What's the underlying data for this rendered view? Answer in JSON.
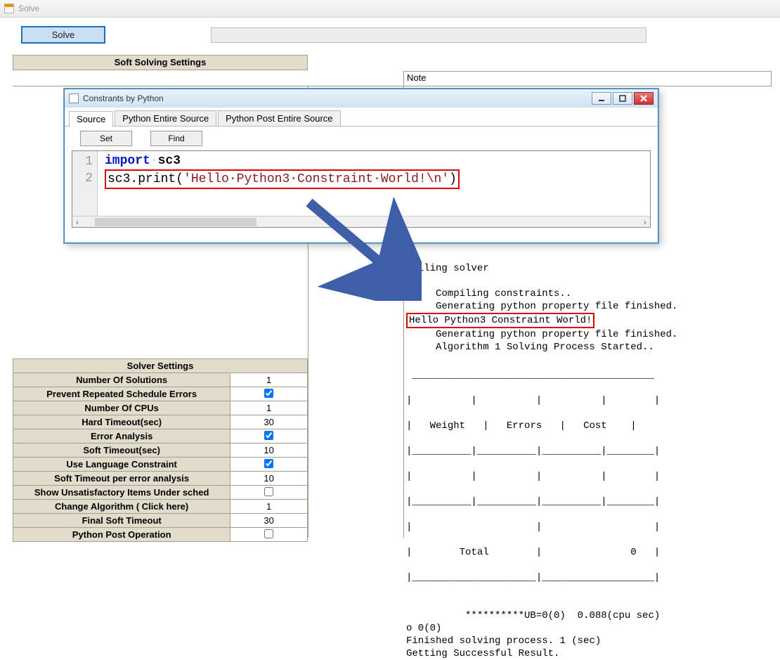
{
  "main_window": {
    "title": "Solve"
  },
  "toolbar": {
    "solve_label": "Solve"
  },
  "soft_settings_header": "Soft Solving Settings",
  "note_label": "Note",
  "dialog": {
    "title": "Constrants by Python",
    "tabs": [
      "Source",
      "Python Entire Source",
      "Python Post Entire Source"
    ],
    "active_tab": 0,
    "buttons": {
      "set": "Set",
      "find": "Find"
    },
    "code": {
      "line_numbers": [
        "1",
        "2"
      ],
      "line1_import": "import",
      "line1_mod": "sc3",
      "line2_call_head": "sc3.print(",
      "line2_str": "'Hello·Python3·Constraint·World!\\n'",
      "line2_call_tail": ")"
    }
  },
  "console": {
    "l1": "Calling solver",
    "l2": "Compiling constraints..",
    "l3": "Generating python property file finished.",
    "hl": "Hello Python3 Constraint World!",
    "l4": "Generating python property file finished.",
    "l5": "Algorithm 1 Solving Process Started..",
    "tbl_weight": "Weight",
    "tbl_errors": "Errors",
    "tbl_cost": "Cost",
    "tbl_total": "Total",
    "tbl_zero": "0",
    "ub_line": "          **********UB=0(0)  0.088(cpu sec)",
    "o_line": "o 0(0)",
    "fin": "Finished solving process. 1 (sec)",
    "get": "Getting Successful Result."
  },
  "solver_settings": {
    "header": "Solver Settings",
    "rows": [
      {
        "label": "Number Of Solutions",
        "value": "1",
        "type": "text"
      },
      {
        "label": "Prevent Repeated Schedule Errors",
        "value": true,
        "type": "check"
      },
      {
        "label": "Number Of CPUs",
        "value": "1",
        "type": "text"
      },
      {
        "label": "Hard Timeout(sec)",
        "value": "30",
        "type": "text"
      },
      {
        "label": "Error Analysis",
        "value": true,
        "type": "check"
      },
      {
        "label": "Soft Timeout(sec)",
        "value": "10",
        "type": "text"
      },
      {
        "label": "Use Language Constraint",
        "value": true,
        "type": "check"
      },
      {
        "label": "Soft Timeout per error analysis",
        "value": "10",
        "type": "text"
      },
      {
        "label": "Show Unsatisfactory Items Under sched",
        "value": false,
        "type": "check"
      },
      {
        "label": "Change Algorithm ( Click here)",
        "value": "1",
        "type": "text"
      },
      {
        "label": "Final Soft Timeout",
        "value": "30",
        "type": "text"
      },
      {
        "label": "Python Post Operation",
        "value": false,
        "type": "check"
      }
    ]
  }
}
